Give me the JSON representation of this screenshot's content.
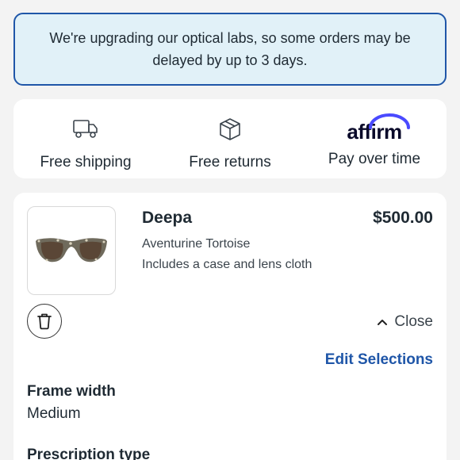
{
  "notice": {
    "text": "We're upgrading our optical labs, so some orders may be delayed by up to 3 days."
  },
  "perks": [
    {
      "label": "Free shipping",
      "icon": "truck-icon"
    },
    {
      "label": "Free returns",
      "icon": "box-icon"
    },
    {
      "label": "Pay over time",
      "icon": "affirm-logo",
      "logo_text": "affirm"
    }
  ],
  "product": {
    "name": "Deepa",
    "price": "$500.00",
    "variant": "Aventurine Tortoise",
    "includes": "Includes a case and lens cloth",
    "image": "sunglasses-icon"
  },
  "actions": {
    "close_label": "Close",
    "edit_label": "Edit Selections"
  },
  "details": [
    {
      "label": "Frame width",
      "value": "Medium"
    },
    {
      "label": "Prescription type",
      "value": ""
    }
  ],
  "colors": {
    "notice_bg": "#e1f1f8",
    "notice_border": "#1f56a8",
    "link": "#1f56a8",
    "affirm_arc": "#4a4aff"
  }
}
